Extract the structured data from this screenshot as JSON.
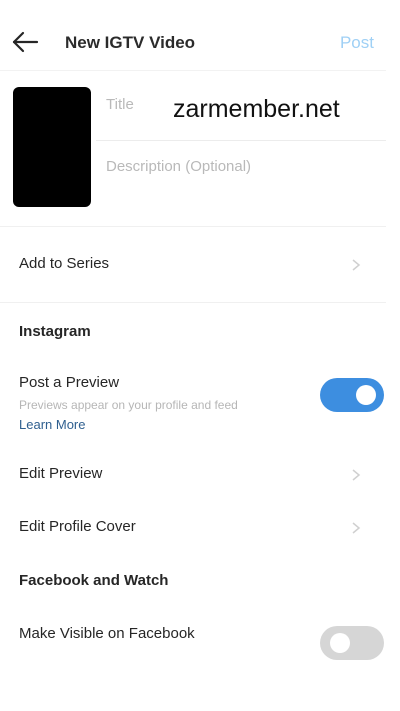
{
  "header": {
    "back_icon": "arrow-left-icon",
    "title": "New IGTV Video",
    "post_label": "Post"
  },
  "media": {
    "title_placeholder": "Title",
    "description_placeholder": "Description (Optional)",
    "watermark": "zarmember.net"
  },
  "series": {
    "label": "Add to Series",
    "icon": "chevron-right-icon"
  },
  "instagram": {
    "section_title": "Instagram",
    "post_preview_label": "Post a Preview",
    "post_preview_subtext": "Previews appear on your profile and feed",
    "learn_more": "Learn More",
    "post_preview_enabled": true,
    "edit_preview_label": "Edit Preview",
    "edit_profile_cover_label": "Edit Profile Cover"
  },
  "facebook": {
    "section_title": "Facebook and Watch",
    "make_visible_label": "Make Visible on Facebook",
    "make_visible_enabled": false
  },
  "colors": {
    "accent": "#3d8ee0",
    "post_link": "#9fd0f5",
    "learn_more": "#2f5f8f"
  }
}
